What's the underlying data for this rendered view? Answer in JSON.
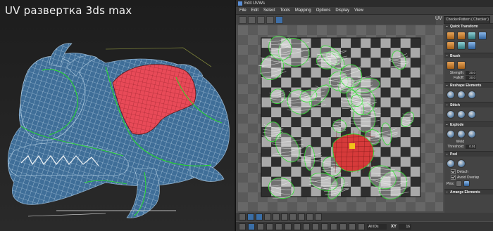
{
  "viewport": {
    "title": "UV развертка 3ds max"
  },
  "uv_window": {
    "title": "Edit UVWs",
    "menu": [
      "File",
      "Edit",
      "Select",
      "Tools",
      "Mapping",
      "Options",
      "Display",
      "View"
    ],
    "uv_label": "UV",
    "map_selector": "CheckerPattern ( Checker )",
    "panel": {
      "quick_transform": "Quick Transform",
      "brush": "Brush",
      "strength_label": "Strength:",
      "strength_value": "20.0",
      "falloff_label": "Falloff:",
      "falloff_value": "20.0",
      "reshape": "Reshape Elements",
      "stitch": "Stitch",
      "explode": "Explode",
      "weld_label": "Weld",
      "threshold_label": "Threshold:",
      "threshold_value": "0.01",
      "peel": "Peel",
      "detach_label": "Detach",
      "avoid_overlap_label": "Avoid Overlap",
      "pins_label": "Pins:",
      "arrange": "Arrange Elements"
    },
    "status": {
      "xy_label": "XY",
      "id_filter": "All IDs",
      "zoom_value": "16"
    },
    "colors": {
      "accent": "#3e6fa8",
      "selection": "#e23a3a",
      "seam": "#1ee01e"
    }
  }
}
